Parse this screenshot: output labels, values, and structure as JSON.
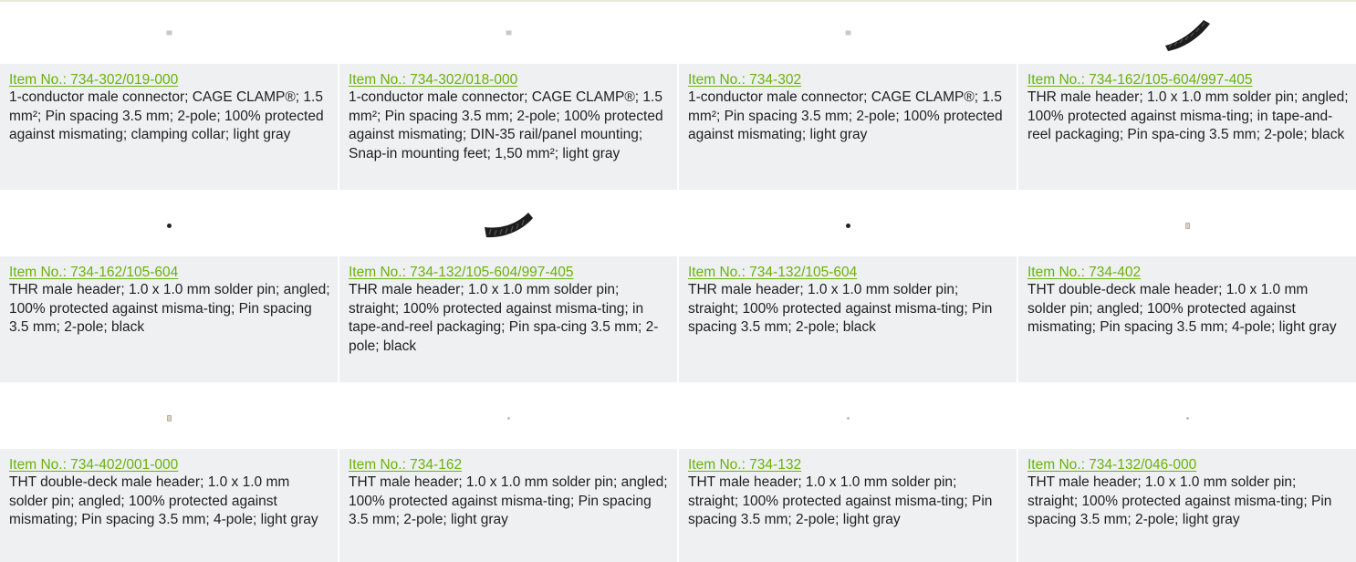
{
  "colors": {
    "link": "#6ab30b",
    "panel": "#eef0f1",
    "text": "#1f1f1f"
  },
  "products": [
    {
      "item": "Item No.: 734-302/019-000",
      "desc": "1-conductor male connector; CAGE CLAMP®; 1.5 mm²; Pin spacing 3.5 mm; 2-pole; 100% protected against mismating; clamping collar; light gray",
      "icon": "connector-thumbnail-icon"
    },
    {
      "item": "Item No.: 734-302/018-000",
      "desc": "1-conductor male connector; CAGE CLAMP®; 1.5 mm²; Pin spacing 3.5 mm; 2-pole; 100% protected against mismating; DIN-35 rail/panel mounting; Snap-in mounting feet; 1,50 mm²; light gray",
      "icon": "connector-thumbnail-icon"
    },
    {
      "item": "Item No.: 734-302",
      "desc": "1-conductor male connector; CAGE CLAMP®; 1.5 mm²; Pin spacing 3.5 mm; 2-pole; 100% protected against mismating; light gray",
      "icon": "connector-thumbnail-icon"
    },
    {
      "item": "Item No.: 734-162/105-604/997-405",
      "desc": "THR male header; 1.0 x 1.0 mm solder pin; angled; 100% protected against misma-ting; in tape-and-reel packaging; Pin spa-cing 3.5 mm; 2-pole; black",
      "icon": "tape-reel-header-icon"
    },
    {
      "item": "Item No.: 734-162/105-604",
      "desc": "THR male header; 1.0 x 1.0 mm solder pin; angled; 100% protected against misma-ting; Pin spacing 3.5 mm; 2-pole; black",
      "icon": "black-header-thumbnail-icon"
    },
    {
      "item": "Item No.: 734-132/105-604/997-405",
      "desc": "THR male header; 1.0 x 1.0 mm solder pin; straight; 100% protected against misma-ting; in tape-and-reel packaging; Pin spa-cing 3.5 mm; 2-pole; black",
      "icon": "tape-reel-header-icon"
    },
    {
      "item": "Item No.: 734-132/105-604",
      "desc": "THR male header; 1.0 x 1.0 mm solder pin; straight; 100% protected against misma-ting; Pin spacing 3.5 mm; 2-pole; black",
      "icon": "black-header-thumbnail-icon"
    },
    {
      "item": "Item No.: 734-402",
      "desc": "THT double-deck male header; 1.0 x 1.0 mm solder pin; angled; 100% protected against mismating; Pin spacing 3.5 mm; 4-pole; light gray",
      "icon": "double-deck-header-icon"
    },
    {
      "item": "Item No.: 734-402/001-000",
      "desc": "THT double-deck male header; 1.0 x 1.0 mm solder pin; angled; 100% protected against mismating; Pin spacing 3.5 mm; 4-pole; light gray",
      "icon": "double-deck-header-icon"
    },
    {
      "item": "Item No.: 734-162",
      "desc": "THT male header; 1.0 x 1.0 mm solder pin; angled; 100% protected against misma-ting; Pin spacing 3.5 mm; 2-pole; light gray",
      "icon": "gray-header-thumbnail-icon"
    },
    {
      "item": "Item No.: 734-132",
      "desc": "THT male header; 1.0 x 1.0 mm solder pin; straight; 100% protected against misma-ting; Pin spacing 3.5 mm; 2-pole; light gray",
      "icon": "gray-header-thumbnail-icon"
    },
    {
      "item": "Item No.: 734-132/046-000",
      "desc": "THT male header; 1.0 x 1.0 mm solder pin; straight; 100% protected against misma-ting; Pin spacing 3.5 mm; 2-pole; light gray",
      "icon": "gray-header-thumbnail-icon"
    }
  ]
}
